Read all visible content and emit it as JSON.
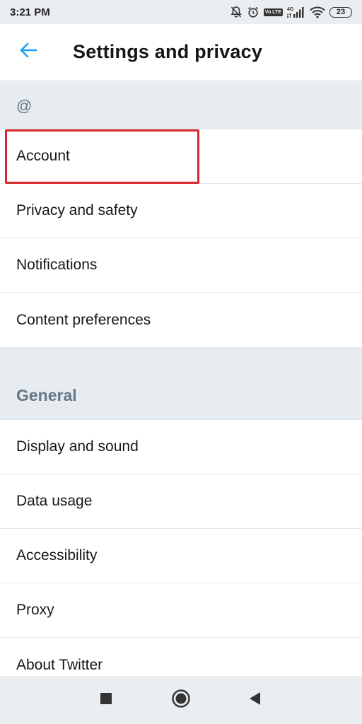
{
  "status_bar": {
    "time": "3:21 PM",
    "network": "4G",
    "volte": "Vo LTE",
    "battery": "23"
  },
  "header": {
    "title": "Settings and privacy"
  },
  "sections": [
    {
      "heading": "@",
      "items": [
        "Account",
        "Privacy and safety",
        "Notifications",
        "Content preferences"
      ]
    },
    {
      "heading": "General",
      "items": [
        "Display and sound",
        "Data usage",
        "Accessibility",
        "Proxy",
        "About Twitter"
      ]
    }
  ],
  "highlighted_item": "Account",
  "colors": {
    "accent": "#1da1f2",
    "section_bg": "#e6ecf0",
    "section_text": "#657786",
    "highlight": "#d8262c"
  }
}
